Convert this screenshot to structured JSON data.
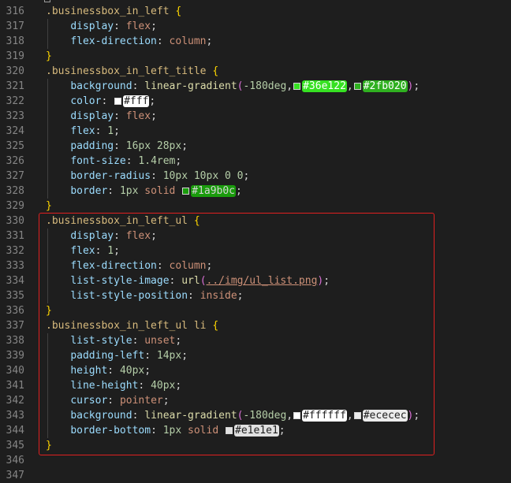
{
  "editor": {
    "highlight_color": "#e02020",
    "lines": [
      {
        "n": "316",
        "parts": [
          {
            "t": ".businessbox_in_left",
            "k": "selector"
          },
          {
            "t": " ",
            "k": "punct"
          },
          {
            "t": "{",
            "k": "brace"
          }
        ]
      },
      {
        "n": "317",
        "parts": [
          {
            "t": "    ",
            "k": "punct"
          },
          {
            "t": "display",
            "k": "prop"
          },
          {
            "t": ": ",
            "k": "colon"
          },
          {
            "t": "flex",
            "k": "val"
          },
          {
            "t": ";",
            "k": "punct"
          }
        ]
      },
      {
        "n": "318",
        "parts": [
          {
            "t": "    ",
            "k": "punct"
          },
          {
            "t": "flex-direction",
            "k": "prop"
          },
          {
            "t": ": ",
            "k": "colon"
          },
          {
            "t": "column",
            "k": "val"
          },
          {
            "t": ";",
            "k": "punct"
          }
        ]
      },
      {
        "n": "319",
        "parts": [
          {
            "t": "}",
            "k": "brace"
          }
        ]
      },
      {
        "n": "320",
        "parts": [
          {
            "t": ".businessbox_in_left_title",
            "k": "selector"
          },
          {
            "t": " ",
            "k": "punct"
          },
          {
            "t": "{",
            "k": "brace"
          }
        ]
      },
      {
        "n": "321",
        "parts": [
          {
            "t": "    ",
            "k": "punct"
          },
          {
            "t": "background",
            "k": "prop"
          },
          {
            "t": ": ",
            "k": "colon"
          },
          {
            "t": "linear-gradient",
            "k": "fn"
          },
          {
            "t": "(",
            "k": "paren"
          },
          {
            "t": "-180deg",
            "k": "num"
          },
          {
            "t": ",",
            "k": "punct"
          },
          {
            "t": "#36e122",
            "k": "color",
            "c": "#36e122",
            "fg": "#ffffff"
          },
          {
            "t": ",",
            "k": "punct"
          },
          {
            "t": "#2fb020",
            "k": "color",
            "c": "#2fb020",
            "fg": "#ffffff"
          },
          {
            "t": ")",
            "k": "paren"
          },
          {
            "t": ";",
            "k": "punct"
          }
        ]
      },
      {
        "n": "322",
        "parts": [
          {
            "t": "    ",
            "k": "punct"
          },
          {
            "t": "color",
            "k": "prop"
          },
          {
            "t": ": ",
            "k": "colon"
          },
          {
            "t": "#fff",
            "k": "color",
            "c": "#ffffff",
            "fg": "#1e1e1e"
          },
          {
            "t": ";",
            "k": "punct"
          }
        ]
      },
      {
        "n": "323",
        "parts": [
          {
            "t": "    ",
            "k": "punct"
          },
          {
            "t": "display",
            "k": "prop"
          },
          {
            "t": ": ",
            "k": "colon"
          },
          {
            "t": "flex",
            "k": "val"
          },
          {
            "t": ";",
            "k": "punct"
          }
        ]
      },
      {
        "n": "324",
        "parts": [
          {
            "t": "    ",
            "k": "punct"
          },
          {
            "t": "flex",
            "k": "prop"
          },
          {
            "t": ": ",
            "k": "colon"
          },
          {
            "t": "1",
            "k": "num"
          },
          {
            "t": ";",
            "k": "punct"
          }
        ]
      },
      {
        "n": "325",
        "parts": [
          {
            "t": "    ",
            "k": "punct"
          },
          {
            "t": "padding",
            "k": "prop"
          },
          {
            "t": ": ",
            "k": "colon"
          },
          {
            "t": "16px 28px",
            "k": "num"
          },
          {
            "t": ";",
            "k": "punct"
          }
        ]
      },
      {
        "n": "326",
        "parts": [
          {
            "t": "    ",
            "k": "punct"
          },
          {
            "t": "font-size",
            "k": "prop"
          },
          {
            "t": ": ",
            "k": "colon"
          },
          {
            "t": "1.4rem",
            "k": "num"
          },
          {
            "t": ";",
            "k": "punct"
          }
        ]
      },
      {
        "n": "327",
        "parts": [
          {
            "t": "    ",
            "k": "punct"
          },
          {
            "t": "border-radius",
            "k": "prop"
          },
          {
            "t": ": ",
            "k": "colon"
          },
          {
            "t": "10px 10px 0 0",
            "k": "num"
          },
          {
            "t": ";",
            "k": "punct"
          }
        ]
      },
      {
        "n": "328",
        "parts": [
          {
            "t": "    ",
            "k": "punct"
          },
          {
            "t": "border",
            "k": "prop"
          },
          {
            "t": ": ",
            "k": "colon"
          },
          {
            "t": "1px",
            "k": "num"
          },
          {
            "t": " ",
            "k": "punct"
          },
          {
            "t": "solid",
            "k": "val"
          },
          {
            "t": " ",
            "k": "punct"
          },
          {
            "t": "#1a9b0c",
            "k": "color",
            "c": "#1a9b0c",
            "fg": "#d4d4d4"
          },
          {
            "t": ";",
            "k": "punct"
          }
        ]
      },
      {
        "n": "329",
        "parts": [
          {
            "t": "}",
            "k": "brace"
          }
        ]
      },
      {
        "n": "330",
        "parts": [
          {
            "t": ".businessbox_in_left_ul",
            "k": "selector"
          },
          {
            "t": " ",
            "k": "punct"
          },
          {
            "t": "{",
            "k": "brace"
          }
        ]
      },
      {
        "n": "331",
        "parts": [
          {
            "t": "    ",
            "k": "punct"
          },
          {
            "t": "display",
            "k": "prop"
          },
          {
            "t": ": ",
            "k": "colon"
          },
          {
            "t": "flex",
            "k": "val"
          },
          {
            "t": ";",
            "k": "punct"
          }
        ]
      },
      {
        "n": "332",
        "parts": [
          {
            "t": "    ",
            "k": "punct"
          },
          {
            "t": "flex",
            "k": "prop"
          },
          {
            "t": ": ",
            "k": "colon"
          },
          {
            "t": "1",
            "k": "num"
          },
          {
            "t": ";",
            "k": "punct"
          }
        ]
      },
      {
        "n": "333",
        "parts": [
          {
            "t": "    ",
            "k": "punct"
          },
          {
            "t": "flex-direction",
            "k": "prop"
          },
          {
            "t": ": ",
            "k": "colon"
          },
          {
            "t": "column",
            "k": "val"
          },
          {
            "t": ";",
            "k": "punct"
          }
        ]
      },
      {
        "n": "334",
        "parts": [
          {
            "t": "    ",
            "k": "punct"
          },
          {
            "t": "list-style-image",
            "k": "prop"
          },
          {
            "t": ": ",
            "k": "colon"
          },
          {
            "t": "url",
            "k": "fn"
          },
          {
            "t": "(",
            "k": "paren"
          },
          {
            "t": "../img/ul_list.png",
            "k": "link"
          },
          {
            "t": ")",
            "k": "paren"
          },
          {
            "t": ";",
            "k": "punct"
          }
        ]
      },
      {
        "n": "335",
        "parts": [
          {
            "t": "    ",
            "k": "punct"
          },
          {
            "t": "list-style-position",
            "k": "prop"
          },
          {
            "t": ": ",
            "k": "colon"
          },
          {
            "t": "inside",
            "k": "val"
          },
          {
            "t": ";",
            "k": "punct"
          }
        ]
      },
      {
        "n": "336",
        "parts": [
          {
            "t": "}",
            "k": "brace"
          }
        ]
      },
      {
        "n": "337",
        "parts": [
          {
            "t": ".businessbox_in_left_ul li",
            "k": "selector"
          },
          {
            "t": " ",
            "k": "punct"
          },
          {
            "t": "{",
            "k": "brace"
          }
        ]
      },
      {
        "n": "338",
        "parts": [
          {
            "t": "    ",
            "k": "punct"
          },
          {
            "t": "list-style",
            "k": "prop"
          },
          {
            "t": ": ",
            "k": "colon"
          },
          {
            "t": "unset",
            "k": "val"
          },
          {
            "t": ";",
            "k": "punct"
          }
        ]
      },
      {
        "n": "339",
        "parts": [
          {
            "t": "    ",
            "k": "punct"
          },
          {
            "t": "padding-left",
            "k": "prop"
          },
          {
            "t": ": ",
            "k": "colon"
          },
          {
            "t": "14px",
            "k": "num"
          },
          {
            "t": ";",
            "k": "punct"
          }
        ]
      },
      {
        "n": "340",
        "parts": [
          {
            "t": "    ",
            "k": "punct"
          },
          {
            "t": "height",
            "k": "prop"
          },
          {
            "t": ": ",
            "k": "colon"
          },
          {
            "t": "40px",
            "k": "num"
          },
          {
            "t": ";",
            "k": "punct"
          }
        ]
      },
      {
        "n": "341",
        "parts": [
          {
            "t": "    ",
            "k": "punct"
          },
          {
            "t": "line-height",
            "k": "prop"
          },
          {
            "t": ": ",
            "k": "colon"
          },
          {
            "t": "40px",
            "k": "num"
          },
          {
            "t": ";",
            "k": "punct"
          }
        ]
      },
      {
        "n": "342",
        "parts": [
          {
            "t": "    ",
            "k": "punct"
          },
          {
            "t": "cursor",
            "k": "prop"
          },
          {
            "t": ": ",
            "k": "colon"
          },
          {
            "t": "pointer",
            "k": "val"
          },
          {
            "t": ";",
            "k": "punct"
          }
        ]
      },
      {
        "n": "343",
        "parts": [
          {
            "t": "    ",
            "k": "punct"
          },
          {
            "t": "background",
            "k": "prop"
          },
          {
            "t": ": ",
            "k": "colon"
          },
          {
            "t": "linear-gradient",
            "k": "fn"
          },
          {
            "t": "(",
            "k": "paren"
          },
          {
            "t": "-180deg",
            "k": "num"
          },
          {
            "t": ",",
            "k": "punct"
          },
          {
            "t": "#ffffff",
            "k": "color",
            "c": "#ffffff",
            "fg": "#1e1e1e"
          },
          {
            "t": ",",
            "k": "punct"
          },
          {
            "t": "#ececec",
            "k": "color",
            "c": "#ececec",
            "fg": "#1e1e1e"
          },
          {
            "t": ")",
            "k": "paren"
          },
          {
            "t": ";",
            "k": "punct"
          }
        ]
      },
      {
        "n": "344",
        "parts": [
          {
            "t": "    ",
            "k": "punct"
          },
          {
            "t": "border-bottom",
            "k": "prop"
          },
          {
            "t": ": ",
            "k": "colon"
          },
          {
            "t": "1px",
            "k": "num"
          },
          {
            "t": " ",
            "k": "punct"
          },
          {
            "t": "solid",
            "k": "val"
          },
          {
            "t": " ",
            "k": "punct"
          },
          {
            "t": "#e1e1e1",
            "k": "color",
            "c": "#e1e1e1",
            "fg": "#1e1e1e"
          },
          {
            "t": ";",
            "k": "punct"
          }
        ]
      },
      {
        "n": "345",
        "parts": [
          {
            "t": "}",
            "k": "brace"
          }
        ]
      },
      {
        "n": "346",
        "parts": []
      },
      {
        "n": "347",
        "parts": []
      }
    ]
  }
}
